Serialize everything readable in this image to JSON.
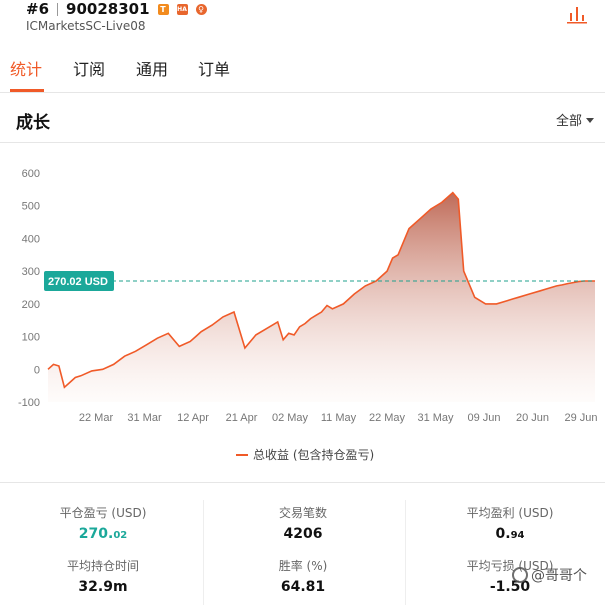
{
  "header": {
    "rank": "#6",
    "account": "90028301",
    "badges": [
      "T",
      "HA",
      "♀"
    ],
    "server": "ICMarketsSC-Live08"
  },
  "tabs": [
    {
      "label": "统计",
      "active": true
    },
    {
      "label": "订阅",
      "active": false
    },
    {
      "label": "通用",
      "active": false
    },
    {
      "label": "订单",
      "active": false
    }
  ],
  "section": {
    "title": "成长",
    "range": "全部"
  },
  "chart_data": {
    "type": "area",
    "ylim": [
      -100,
      600
    ],
    "yticks": [
      600,
      500,
      400,
      300,
      200,
      100,
      0,
      -100
    ],
    "xticks": [
      "22 Mar",
      "31 Mar",
      "12 Apr",
      "21 Apr",
      "02 May",
      "11 May",
      "22 May",
      "31 May",
      "09 Jun",
      "20 Jun",
      "29 Jun"
    ],
    "reference_line": {
      "value": 270.02,
      "label": "270.02 USD"
    },
    "series": [
      {
        "name": "总收益 (包含持仓盈亏)",
        "x": [
          0,
          0.01,
          0.02,
          0.03,
          0.04,
          0.05,
          0.06,
          0.08,
          0.1,
          0.12,
          0.14,
          0.16,
          0.18,
          0.2,
          0.22,
          0.24,
          0.26,
          0.27,
          0.28,
          0.3,
          0.32,
          0.34,
          0.36,
          0.38,
          0.4,
          0.42,
          0.43,
          0.44,
          0.45,
          0.46,
          0.47,
          0.48,
          0.49,
          0.5,
          0.51,
          0.52,
          0.54,
          0.56,
          0.58,
          0.6,
          0.62,
          0.63,
          0.64,
          0.66,
          0.68,
          0.7,
          0.72,
          0.74,
          0.75,
          0.76,
          0.78,
          0.8,
          0.82,
          0.84,
          0.85,
          0.86,
          0.88,
          0.9,
          0.91,
          0.92,
          0.93,
          0.94,
          0.95,
          0.96,
          0.97,
          0.98,
          0.99,
          1.0
        ],
        "values": [
          0,
          15,
          10,
          -55,
          -40,
          -25,
          -20,
          -5,
          0,
          15,
          40,
          55,
          75,
          95,
          110,
          70,
          85,
          100,
          115,
          135,
          160,
          175,
          65,
          105,
          125,
          145,
          90,
          110,
          105,
          130,
          140,
          155,
          165,
          175,
          195,
          185,
          200,
          230,
          255,
          270,
          300,
          340,
          350,
          430,
          460,
          490,
          510,
          540,
          520,
          300,
          220,
          200,
          200,
          210,
          215,
          220,
          230,
          240,
          245,
          250,
          255,
          258,
          262,
          265,
          268,
          270,
          270,
          270
        ]
      }
    ],
    "legend": "bottom-center"
  },
  "stats": {
    "closed_pl_label": "平仓盈亏 (USD)",
    "closed_pl_int": "270.",
    "closed_pl_dec": "02",
    "trades_label": "交易笔数",
    "trades": "4206",
    "avg_profit_label": "平均盈利 (USD)",
    "avg_profit_int": "0.",
    "avg_profit_dec": "94",
    "hold_time_label": "平均持仓时间",
    "hold_time": "32.9m",
    "win_rate_label": "胜率 (%)",
    "win_rate": "64.81",
    "avg_loss_label": "平均亏损 (USD)",
    "avg_loss": "-1.50"
  },
  "watermark": "@哥哥个",
  "colors": {
    "accent": "#f05a28",
    "profit": "#1ba89a",
    "ref_line": "#1fa08e"
  }
}
